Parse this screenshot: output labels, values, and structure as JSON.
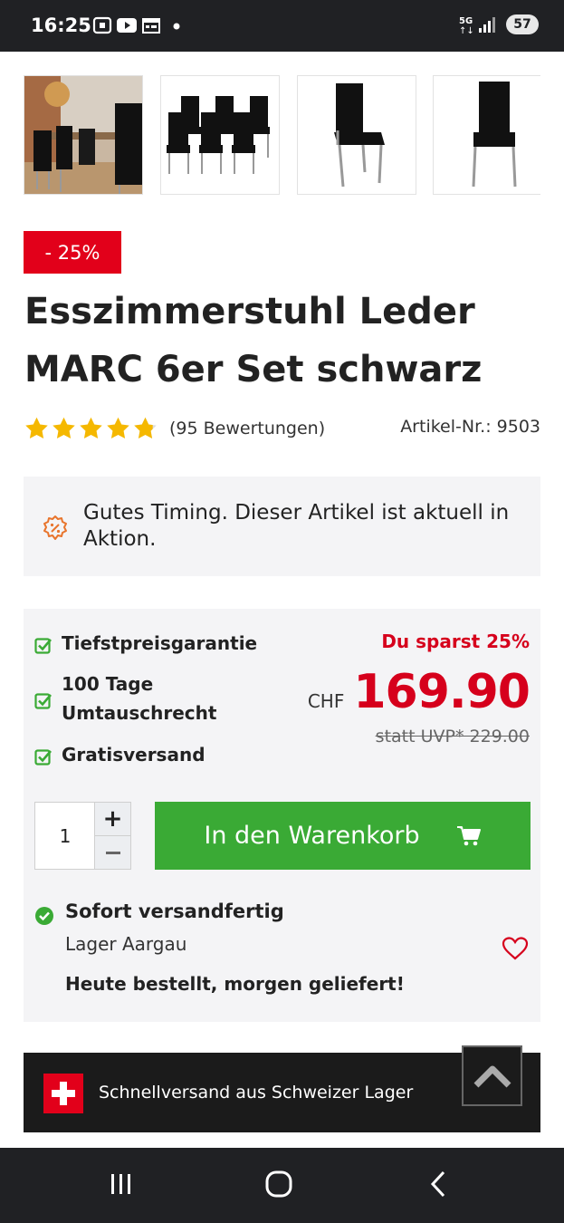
{
  "status_bar": {
    "time": "16:25",
    "network": "5G",
    "battery": "57"
  },
  "gallery": {
    "thumbnails": [
      {
        "alt": "Esszimmer mit Stühlen"
      },
      {
        "alt": "6er Set Stühle"
      },
      {
        "alt": "Stuhl schräg"
      },
      {
        "alt": "Stuhl frontal"
      }
    ]
  },
  "product": {
    "discount_badge": "- 25%",
    "title": "Esszimmerstuhl Leder MARC 6er Set schwarz",
    "rating_value": 4.8,
    "rating_max": 5,
    "reviews_text": "(95 Bewertungen)",
    "article_nr": "Artikel-Nr.: 9503"
  },
  "timing": {
    "text": "Gutes Timing. Dieser Artikel ist aktuell in Aktion."
  },
  "buybox": {
    "features": [
      "Tiefstpreisgarantie",
      "100 Tage Umtauschrecht",
      "Gratisversand"
    ],
    "savings": "Du sparst 25%",
    "currency": "CHF",
    "price": "169.90",
    "old_price": "statt UVP* 229.00",
    "quantity": "1",
    "qty_plus": "+",
    "cart_button": "In den Warenkorb",
    "shipping_status": "Sofort versandfertig",
    "warehouse": "Lager Aargau",
    "delivery_note": "Heute bestellt, morgen geliefert!"
  },
  "swiss_bar": {
    "text": "Schnellversand aus Schweizer Lager"
  },
  "colors": {
    "accent_red": "#e2001a",
    "cart_green": "#3aaa35",
    "check_green": "#3aaa35",
    "timing_orange": "#e8742c"
  }
}
